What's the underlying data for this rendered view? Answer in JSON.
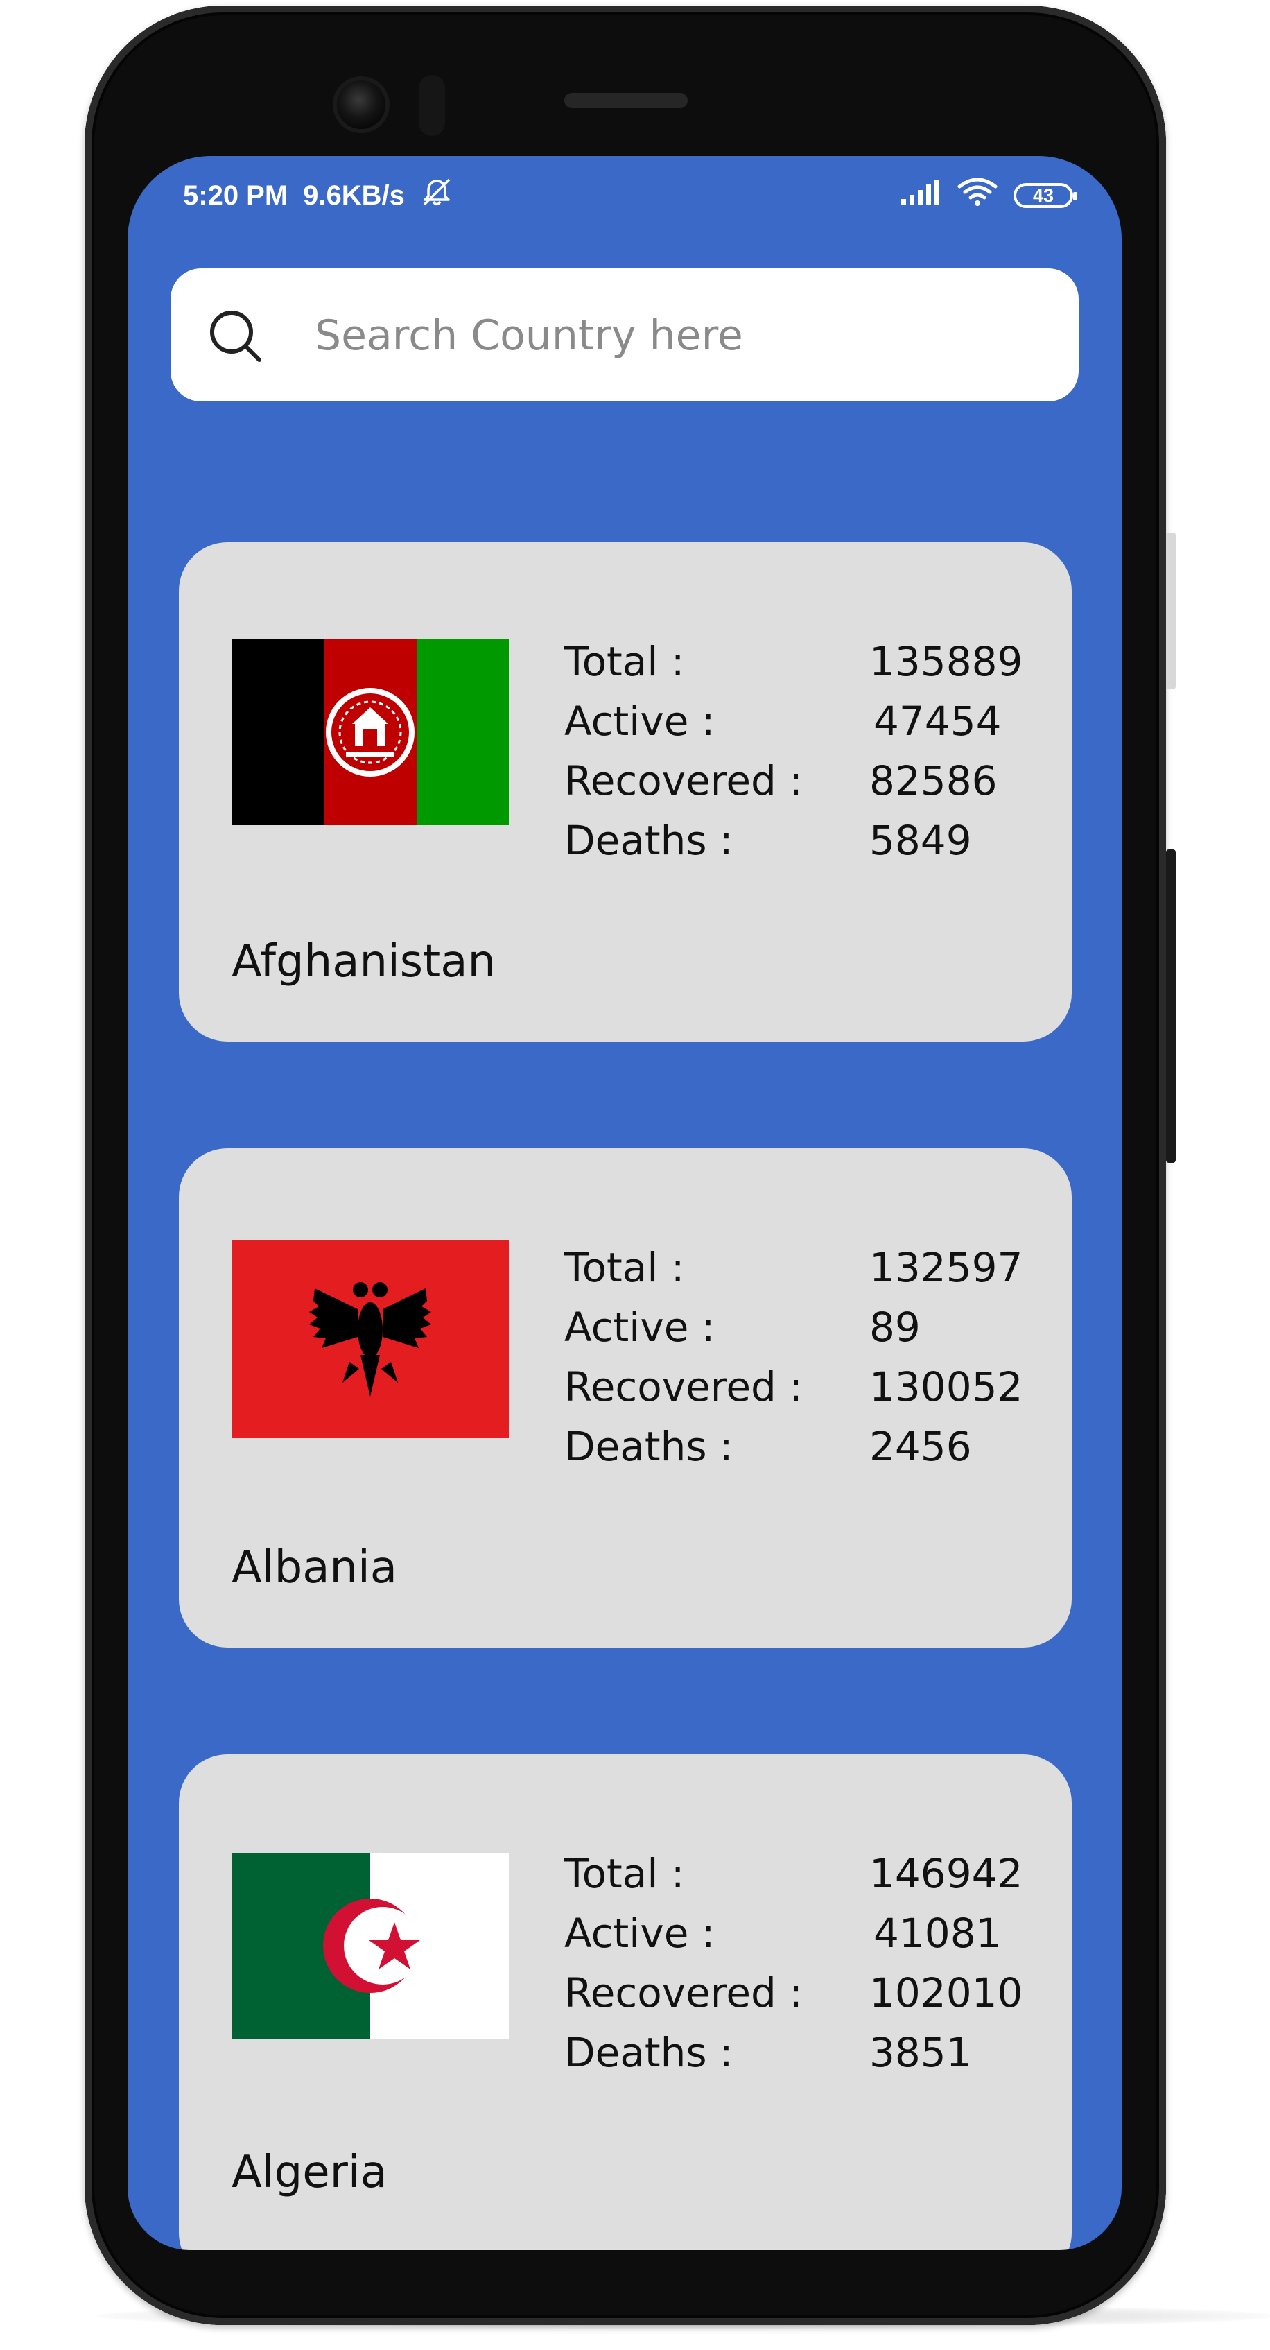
{
  "status_bar": {
    "time": "5:20 PM",
    "speed": "9.6KB/s",
    "battery": "43",
    "icons": [
      "muted-alarm-icon",
      "signal-icon",
      "wifi-icon",
      "battery-icon"
    ]
  },
  "search": {
    "placeholder": "Search Country here",
    "value": ""
  },
  "labels": {
    "total": "Total :",
    "active": "Active :",
    "recovered": "Recovered :",
    "deaths": "Deaths :"
  },
  "countries": [
    {
      "name": "Afghanistan",
      "total": "135889",
      "active": "47454",
      "recovered": "82586",
      "deaths": "5849",
      "flag": "afghanistan-flag"
    },
    {
      "name": "Albania",
      "total": "132597",
      "active": "89",
      "recovered": "130052",
      "deaths": "2456",
      "flag": "albania-flag"
    },
    {
      "name": "Algeria",
      "total": "146942",
      "active": "41081",
      "recovered": "102010",
      "deaths": "3851",
      "flag": "algeria-flag"
    }
  ],
  "colors": {
    "screen_background": "#3b69c8",
    "card_background": "#dedede",
    "search_background": "#ffffff"
  }
}
